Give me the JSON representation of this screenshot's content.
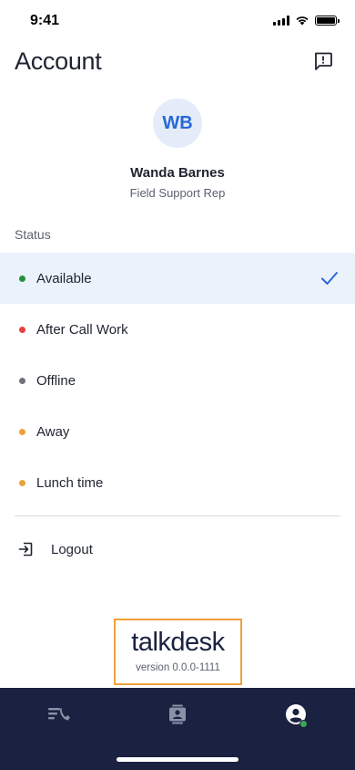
{
  "status_bar": {
    "time": "9:41"
  },
  "header": {
    "title": "Account"
  },
  "profile": {
    "initials": "WB",
    "name": "Wanda Barnes",
    "role": "Field Support Rep"
  },
  "status_section": {
    "label": "Status",
    "items": [
      {
        "label": "Available",
        "color": "#23903f",
        "selected": true
      },
      {
        "label": "After Call Work",
        "color": "#e8433a",
        "selected": false
      },
      {
        "label": "Offline",
        "color": "#6f737c",
        "selected": false
      },
      {
        "label": "Away",
        "color": "#e9a23b",
        "selected": false
      },
      {
        "label": "Lunch time",
        "color": "#e9a23b",
        "selected": false
      }
    ]
  },
  "logout": {
    "label": "Logout"
  },
  "footer": {
    "brand": "talkdesk",
    "version": "version 0.0.0-1111"
  },
  "tab_bar": {
    "tabs": [
      {
        "name": "conversations-icon",
        "active": false
      },
      {
        "name": "contacts-icon",
        "active": false
      },
      {
        "name": "account-icon",
        "active": true
      }
    ],
    "presence_color": "#3aa45a"
  },
  "colors": {
    "accent": "#2767d9",
    "nav_bg": "#1b2140",
    "selected_bg": "#ebf2fb",
    "highlight_border": "#f0a13c"
  }
}
